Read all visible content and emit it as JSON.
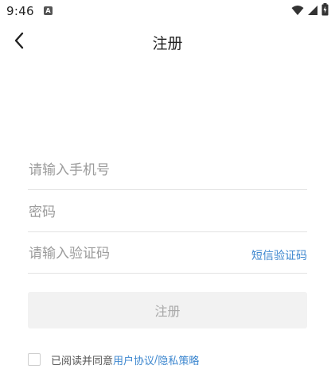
{
  "status_bar": {
    "time": "9:46",
    "notification_glyph": "A"
  },
  "header": {
    "title": "注册",
    "back_icon": "chevron-left-icon"
  },
  "form": {
    "phone_placeholder": "请输入手机号",
    "password_placeholder": "密码",
    "code_placeholder": "请输入验证码",
    "sms_code_label": "短信验证码",
    "submit_label": "注册"
  },
  "agreement": {
    "prefix": "已阅读并同意",
    "user_agreement": "用户协议",
    "separator": "/",
    "privacy_policy": "隐私策略"
  },
  "colors": {
    "link": "#3d87cf",
    "button_bg": "#f2f2f2",
    "button_text": "#a8a8a8",
    "divider": "#e2e2e2"
  }
}
